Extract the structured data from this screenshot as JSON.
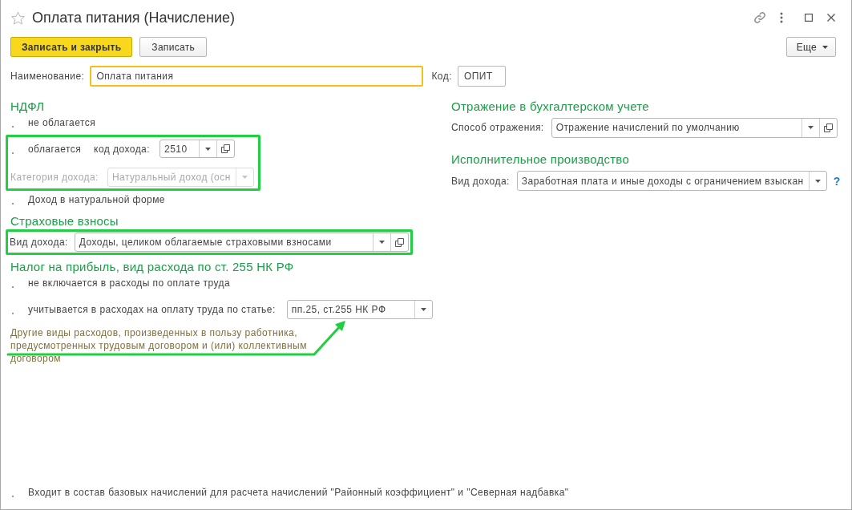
{
  "window": {
    "title": "Оплата питания (Начисление)"
  },
  "toolbar": {
    "buttons": [
      {
        "label": "Записать и закрыть",
        "kind": "primary"
      },
      {
        "label": "Записать",
        "kind": "secondary"
      }
    ],
    "more": {
      "label": "Еще"
    }
  },
  "header": {
    "name": {
      "label": "Наименование:",
      "value": "Оплата питания",
      "focused": true
    },
    "code": {
      "label": "Код:",
      "value": "ОПИТ",
      "focused": false
    }
  },
  "ndfl": {
    "title": "НДФЛ",
    "not_taxed": {
      "label": "не облагается"
    },
    "taxed": {
      "highlighted": true,
      "label": "облагается",
      "code": {
        "label": "код дохода:",
        "value": "2510",
        "open_button": true,
        "disabled": false
      },
      "category": {
        "label": "Категория дохода:",
        "value": "Натуральный доход (осн",
        "open_button": false,
        "disabled": true
      }
    },
    "natural": {
      "label": "Доход в натуральной форме"
    }
  },
  "insurance": {
    "title": "Страховые взносы",
    "highlighted": true,
    "field": {
      "label": "Вид дохода:",
      "value": "Доходы, целиком облагаемые страховыми взносами",
      "open_button": true,
      "disabled": false
    }
  },
  "profit_tax": {
    "title": "Налог на прибыль, вид расхода по ст. 255 НК РФ",
    "options": [
      {
        "label": "не включается в расходы по оплате труда"
      },
      {
        "label": "учитывается в расходах на оплату труда по статье:",
        "field": {
          "value": "пп.25, ст.255 НК РФ",
          "open_button": false,
          "disabled": false
        }
      }
    ],
    "note": {
      "text": "Другие виды расходов, произведенных в пользу работника, предусмотренных трудовым договором и (или) коллективным договором",
      "annotated": true
    }
  },
  "accounting": {
    "title": "Отражение в бухгалтерском учете",
    "field": {
      "label": "Способ отражения:",
      "value": "Отражение начислений по умолчанию",
      "open_button": true,
      "disabled": false
    }
  },
  "enforcement": {
    "title": "Исполнительное производство",
    "field": {
      "label": "Вид дохода:",
      "value": "Заработная плата и иные доходы с ограничением взыскан",
      "open_button": false,
      "disabled": false,
      "help": "?"
    }
  },
  "footer": {
    "label": "Входит в состав базовых начислений для расчета начислений \"Районный коэффициент\" и \"Северная надбавка\""
  }
}
